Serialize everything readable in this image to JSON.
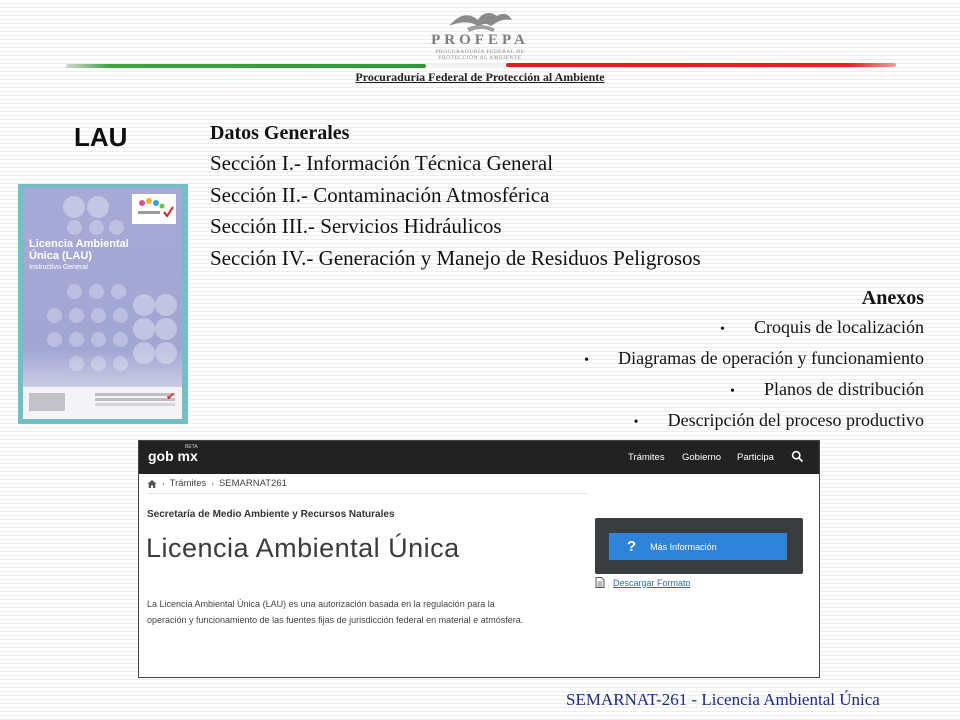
{
  "header": {
    "logo_text": "PROFEPA",
    "logo_subtext": "PROCURADURÍA FEDERAL DE PROTECCIÓN AL AMBIENTE",
    "subtitle": "Procuraduría Federal de Protección al Ambiente"
  },
  "lau_label": "LAU",
  "book_cover": {
    "title": "Licencia Ambiental Única (LAU)",
    "subtitle": "Instructivo General"
  },
  "sections": {
    "heading": "Datos Generales",
    "items": [
      "Sección I.- Información Técnica General",
      "Sección II.- Contaminación Atmosférica",
      "Sección III.- Servicios Hidráulicos",
      "Sección IV.- Generación y Manejo de Residuos Peligrosos"
    ]
  },
  "anexos": {
    "heading": "Anexos",
    "items": [
      "Croquis de localización",
      "Diagramas de operación y funcionamiento",
      "Planos de distribución",
      "Descripción del proceso productivo"
    ]
  },
  "screenshot": {
    "logo": "gob mx",
    "beta": "BETA",
    "nav": [
      "Trámites",
      "Gobierno",
      "Participa"
    ],
    "breadcrumb": [
      "Trámites",
      "SEMARNAT261"
    ],
    "secretaria": "Secretaría de Medio Ambiente y Recursos Naturales",
    "title": "Licencia Ambiental Única",
    "description": "La Licencia Ambiental Única (LAU) es una autorización basada en la regulación para la operación y funcionamiento de las fuentes fijas de jurisdicción federal en material e atmósfera.",
    "info_button": "Más Información",
    "info_button_icon": "?",
    "download_link": "Descargar Formato",
    "colors": {
      "navbar": "#222222",
      "button": "#2f83d9",
      "info_box": "#3a3d40",
      "link": "#2a6ebd"
    }
  },
  "footer": "SEMARNAT-261 - Licencia Ambiental Única",
  "colors": {
    "flag_green": "#2e9a34",
    "flag_red": "#e42222",
    "footer_text": "#1d2a8a",
    "book_frame": "#72bfc4"
  }
}
